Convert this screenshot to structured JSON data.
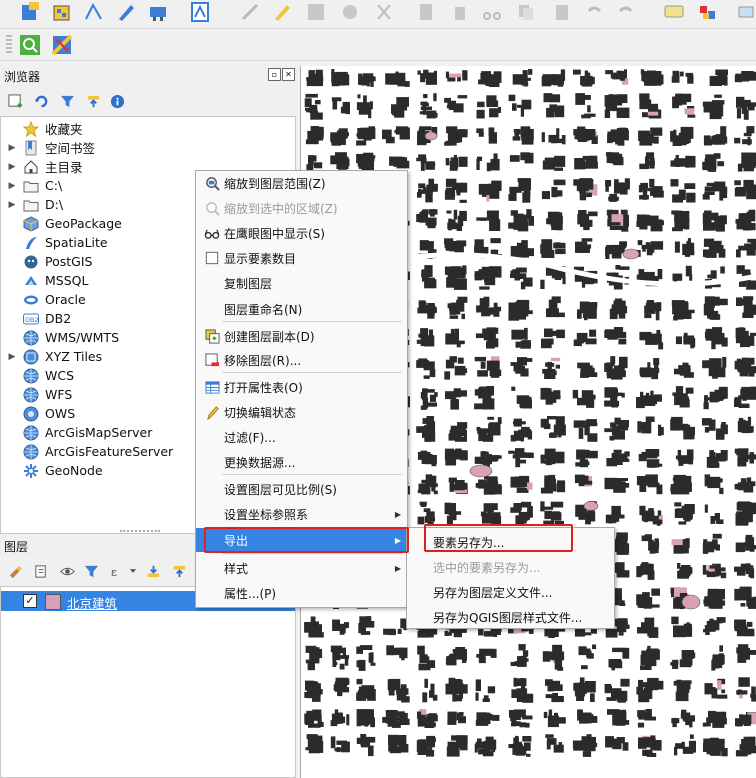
{
  "browser": {
    "title": "浏览器",
    "items": [
      {
        "label": "收藏夹",
        "icon": "star-icon",
        "expand": false
      },
      {
        "label": "空间书签",
        "icon": "bookmark-icon",
        "expand": true
      },
      {
        "label": "主目录",
        "icon": "home-icon",
        "expand": true
      },
      {
        "label": "C:\\",
        "icon": "folder-icon",
        "expand": true
      },
      {
        "label": "D:\\",
        "icon": "folder-icon",
        "expand": true
      },
      {
        "label": "GeoPackage",
        "icon": "geopackage-icon",
        "expand": false
      },
      {
        "label": "SpatiaLite",
        "icon": "spatialite-icon",
        "expand": false
      },
      {
        "label": "PostGIS",
        "icon": "postgis-icon",
        "expand": false
      },
      {
        "label": "MSSQL",
        "icon": "mssql-icon",
        "expand": false
      },
      {
        "label": "Oracle",
        "icon": "oracle-icon",
        "expand": false
      },
      {
        "label": "DB2",
        "icon": "db2-icon",
        "expand": false
      },
      {
        "label": "WMS/WMTS",
        "icon": "globe-icon",
        "expand": false
      },
      {
        "label": "XYZ Tiles",
        "icon": "xyz-tiles-icon",
        "expand": true
      },
      {
        "label": "WCS",
        "icon": "globe-icon",
        "expand": false
      },
      {
        "label": "WFS",
        "icon": "globe-icon",
        "expand": false
      },
      {
        "label": "OWS",
        "icon": "ows-icon",
        "expand": false
      },
      {
        "label": "ArcGisMapServer",
        "icon": "globe-icon",
        "expand": false
      },
      {
        "label": "ArcGisFeatureServer",
        "icon": "globe-icon",
        "expand": false
      },
      {
        "label": "GeoNode",
        "icon": "geonode-icon",
        "expand": false
      }
    ]
  },
  "layers": {
    "title": "图层",
    "layer_name": "北京建筑",
    "checked": true,
    "swatch_color": "#d9a1b6"
  },
  "context_menu": {
    "items": [
      {
        "label": "缩放到图层范围(Z)",
        "icon": "zoom-layer-icon",
        "disabled": false
      },
      {
        "label": "缩放到选中的区域(Z)",
        "icon": "zoom-selection-icon",
        "disabled": true
      },
      {
        "label": "在鹰眼图中显示(S)",
        "icon": "overview-icon",
        "disabled": false
      },
      {
        "label": "显示要素数目",
        "icon": "checkbox-icon",
        "disabled": false
      },
      {
        "label": "复制图层",
        "icon": "",
        "disabled": false
      },
      {
        "label": "图层重命名(N)",
        "icon": "",
        "disabled": false
      },
      {
        "label": "创建图层副本(D)",
        "icon": "duplicate-layer-icon",
        "disabled": false
      },
      {
        "label": "移除图层(R)...",
        "icon": "remove-layer-icon",
        "disabled": false
      },
      {
        "label": "打开属性表(O)",
        "icon": "attribute-table-icon",
        "disabled": false
      },
      {
        "label": "切换编辑状态",
        "icon": "pencil-icon",
        "disabled": false
      },
      {
        "label": "过滤(F)...",
        "icon": "",
        "disabled": false
      },
      {
        "label": "更换数据源...",
        "icon": "",
        "disabled": false
      },
      {
        "label": "设置图层可见比例(S)",
        "icon": "",
        "disabled": false
      },
      {
        "label": "设置坐标参照系",
        "icon": "",
        "disabled": false,
        "submenu": true
      },
      {
        "label": "导出",
        "icon": "",
        "disabled": false,
        "submenu": true,
        "active": true
      },
      {
        "label": "样式",
        "icon": "",
        "disabled": false,
        "submenu": true
      },
      {
        "label": "属性...(P)",
        "icon": "",
        "disabled": false
      }
    ]
  },
  "export_submenu": {
    "items": [
      {
        "label": "要素另存为...",
        "disabled": false
      },
      {
        "label": "选中的要素另存为...",
        "disabled": true
      },
      {
        "label": "另存为图层定义文件...",
        "disabled": false
      },
      {
        "label": "另存为QGIS图层样式文件...",
        "disabled": false
      }
    ]
  },
  "colors": {
    "highlight": "#3584e4",
    "annotation_box": "#e02020",
    "building_fill": "#2b2b2b",
    "pink_feature": "#d9a1b6"
  }
}
